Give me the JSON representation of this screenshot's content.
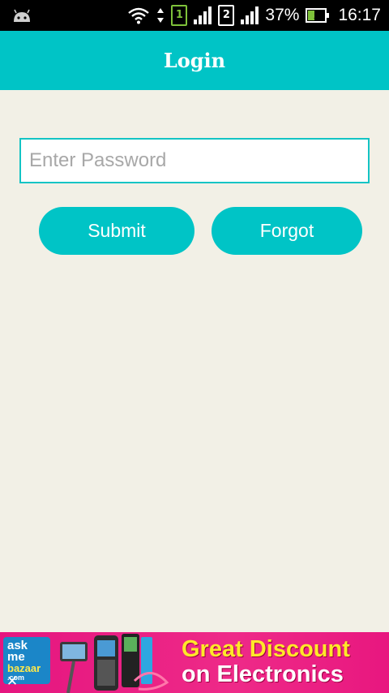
{
  "status_bar": {
    "battery": "37%",
    "battery_level": 0.37,
    "time": "16:17",
    "sim1_label": "1",
    "sim2_label": "2",
    "icons": [
      "android-icon",
      "wifi-icon",
      "data-arrows-icon",
      "sim1-icon",
      "signal-icon",
      "sim2-icon",
      "signal-icon",
      "battery-charging-icon"
    ]
  },
  "app_bar": {
    "title": "Login",
    "color": "#00c4c6"
  },
  "form": {
    "password_placeholder": "Enter Password",
    "password_value": "",
    "submit_label": "Submit",
    "forgot_label": "Forgot"
  },
  "ad": {
    "brand_line1": "ask",
    "brand_line2": "me",
    "brand_line3": "bazaar",
    "brand_line4": ".com",
    "headline_line1": "Great Discount",
    "headline_line2": "on Electronics",
    "close_icon": "close-icon"
  },
  "colors": {
    "accent": "#00c4c6",
    "background": "#f2f0e6",
    "ad_background": "#e5157f",
    "ad_headline": "#ffe829"
  }
}
